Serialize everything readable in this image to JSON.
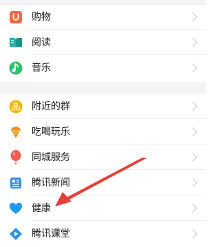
{
  "menu": {
    "group1": [
      {
        "label": "购物",
        "icon": "shopping-bag-icon",
        "color": "#f2683f"
      },
      {
        "label": "阅读",
        "icon": "book-icon",
        "color": "#1fb3a0"
      },
      {
        "label": "音乐",
        "icon": "music-note-icon",
        "color": "#2cc16b"
      }
    ],
    "group2": [
      {
        "label": "附近的群",
        "icon": "nearby-groups-icon",
        "color": "#f6b400"
      },
      {
        "label": "吃喝玩乐",
        "icon": "ice-cream-icon",
        "color": "#f58a1f"
      },
      {
        "label": "同城服务",
        "icon": "balloon-icon",
        "color": "#f15b4f"
      },
      {
        "label": "腾讯新闻",
        "icon": "newspaper-icon",
        "color": "#2f8ff0"
      },
      {
        "label": "健康",
        "icon": "heart-icon",
        "color": "#1e9bf0"
      },
      {
        "label": "腾讯课堂",
        "icon": "classroom-icon",
        "color": "#2a8fe8"
      }
    ]
  },
  "annotation": {
    "color": "#e43f36"
  }
}
